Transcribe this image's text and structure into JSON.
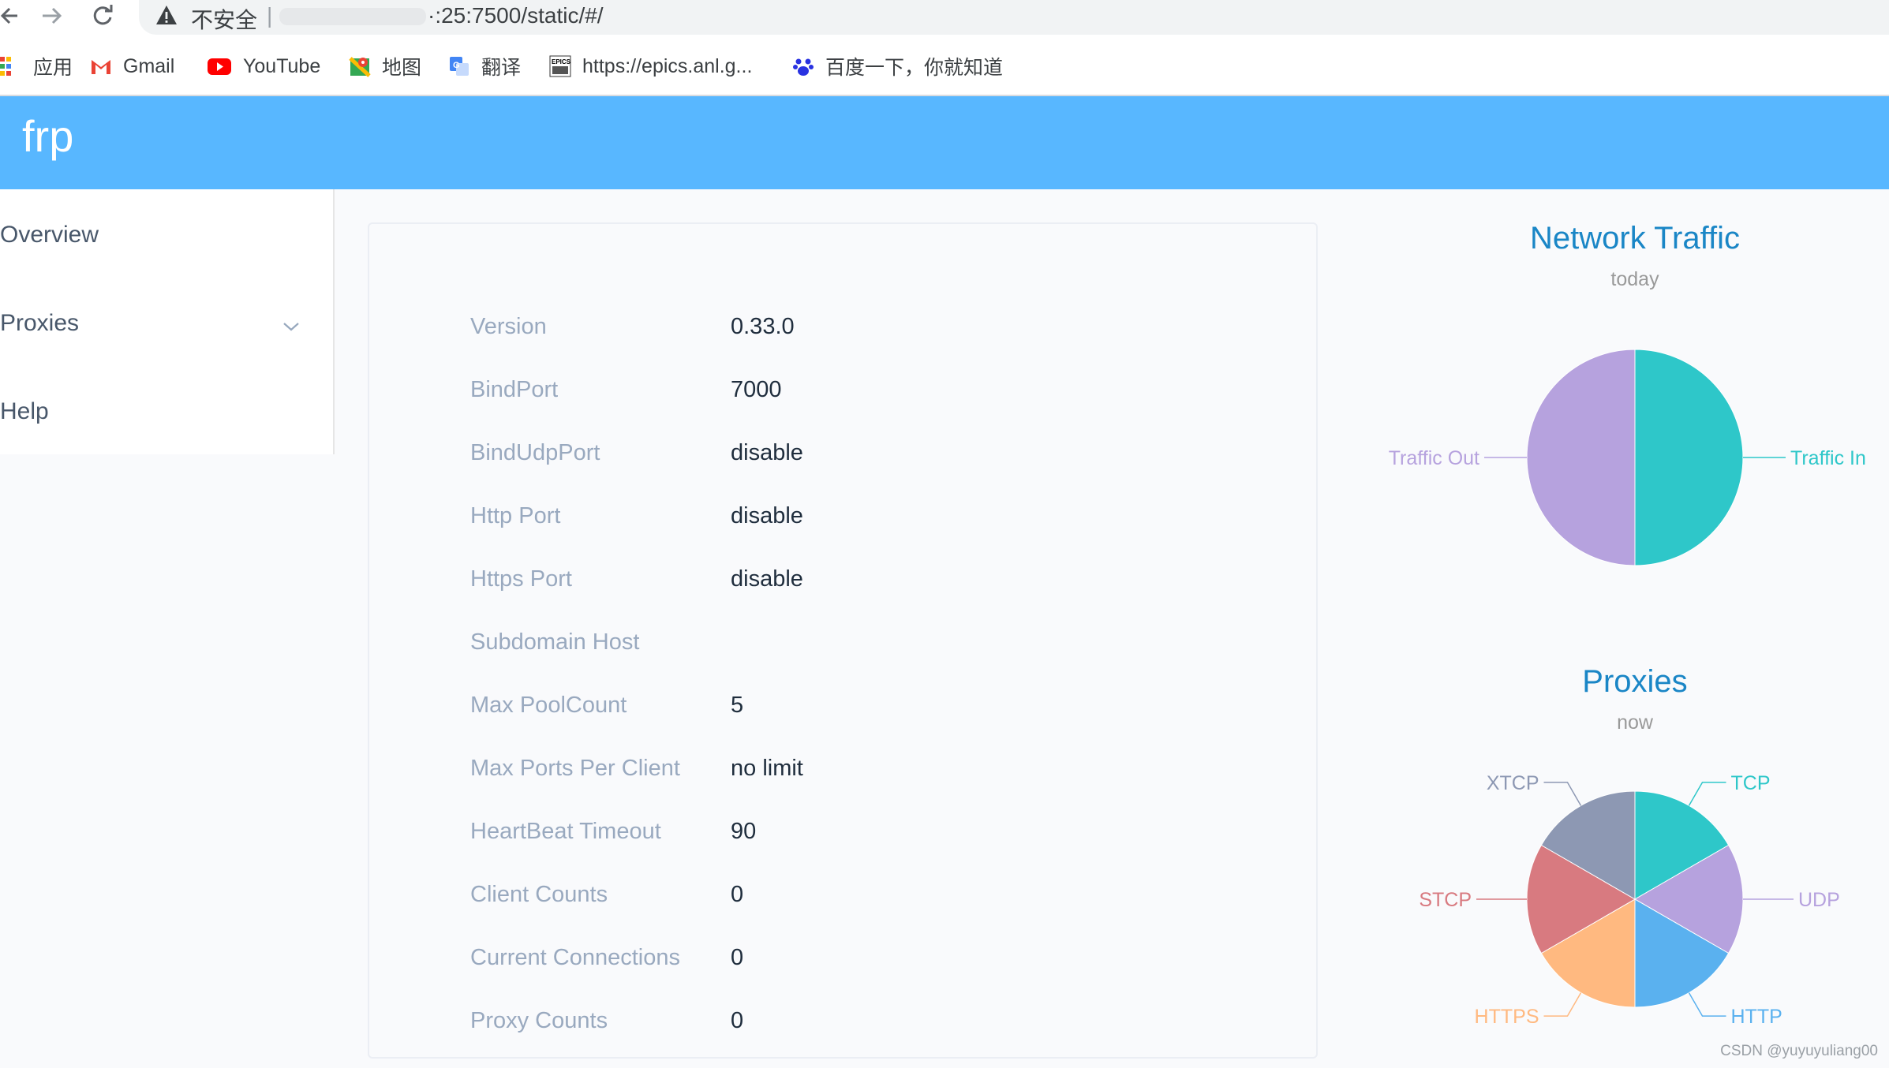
{
  "browser": {
    "security_label": "不安全",
    "separator": "|",
    "url_visible": "·:25:7500/static/#/",
    "bookmarks": [
      {
        "label": "应用",
        "icon": "apps-grid-icon"
      },
      {
        "label": "Gmail",
        "icon": "gmail-icon"
      },
      {
        "label": "YouTube",
        "icon": "youtube-icon"
      },
      {
        "label": "地图",
        "icon": "maps-icon"
      },
      {
        "label": "翻译",
        "icon": "translate-icon"
      },
      {
        "label": "https://epics.anl.g...",
        "icon": "epics-icon"
      },
      {
        "label": "百度一下，你就知道",
        "icon": "baidu-paw-icon"
      }
    ]
  },
  "header": {
    "brand": "frp",
    "color": "#58b7ff"
  },
  "sidebar": {
    "items": [
      {
        "label": "Overview"
      },
      {
        "label": "Proxies"
      },
      {
        "label": "Help"
      }
    ]
  },
  "server_info": {
    "rows": [
      {
        "label": "Version",
        "value": "0.33.0"
      },
      {
        "label": "BindPort",
        "value": "7000"
      },
      {
        "label": "BindUdpPort",
        "value": "disable"
      },
      {
        "label": "Http Port",
        "value": "disable"
      },
      {
        "label": "Https Port",
        "value": "disable"
      },
      {
        "label": "Subdomain Host",
        "value": ""
      },
      {
        "label": "Max PoolCount",
        "value": "5"
      },
      {
        "label": "Max Ports Per Client",
        "value": "no limit"
      },
      {
        "label": "HeartBeat Timeout",
        "value": "90"
      },
      {
        "label": "Client Counts",
        "value": "0"
      },
      {
        "label": "Current Connections",
        "value": "0"
      },
      {
        "label": "Proxy Counts",
        "value": "0"
      }
    ]
  },
  "chart_data": [
    {
      "type": "pie",
      "title": "Network Traffic",
      "subtitle": "today",
      "categories": [
        "Traffic In",
        "Traffic Out"
      ],
      "values": [
        1,
        1
      ],
      "colors": [
        "#2ec7c9",
        "#b6a2de"
      ]
    },
    {
      "type": "pie",
      "title": "Proxies",
      "subtitle": "now",
      "categories": [
        "TCP",
        "UDP",
        "HTTP",
        "HTTPS",
        "STCP",
        "XTCP"
      ],
      "values": [
        1,
        1,
        1,
        1,
        1,
        1
      ],
      "colors": [
        "#2ec7c9",
        "#b6a2de",
        "#5ab1ef",
        "#ffb980",
        "#d87a80",
        "#8d98b3"
      ]
    }
  ],
  "watermark": "CSDN @yuyuyuliang00"
}
